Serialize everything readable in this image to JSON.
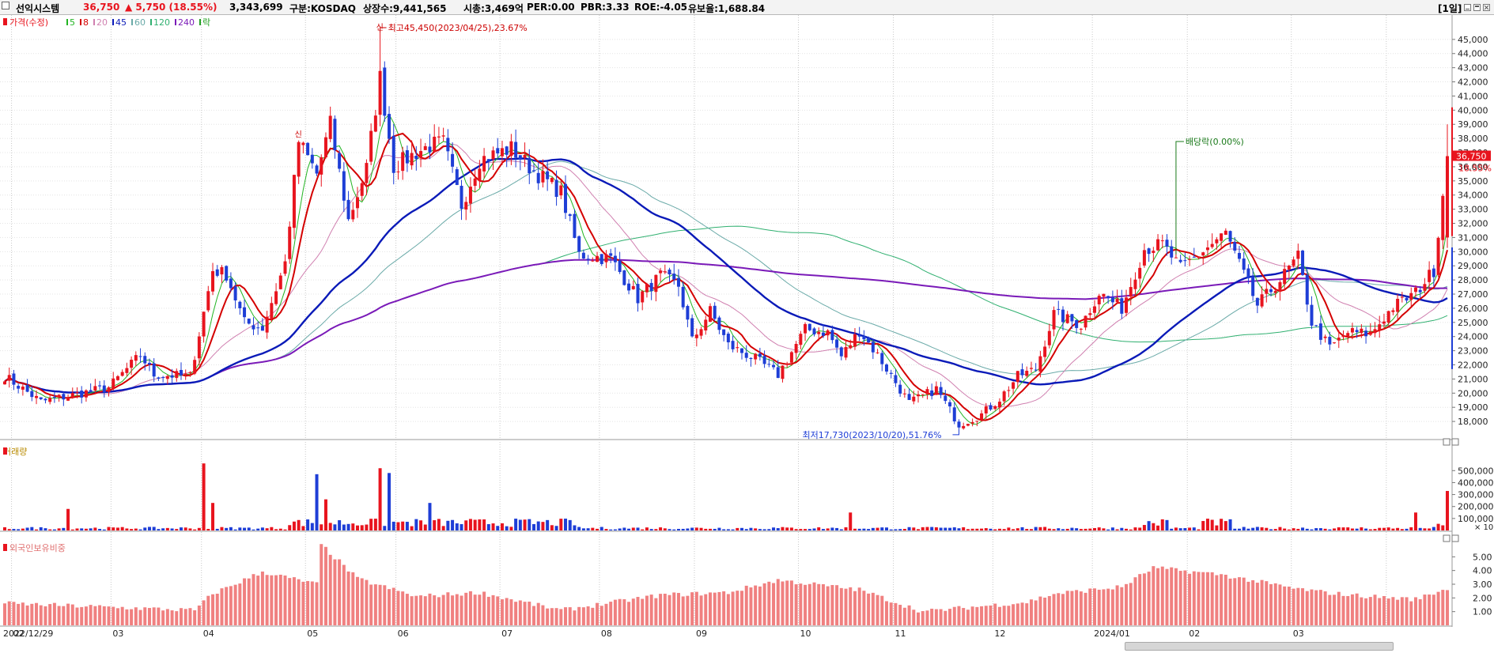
{
  "header": {
    "name": "선익시스템",
    "price": "36,750",
    "change": "▲ 5,750 (18.55%)",
    "volume": "3,343,699",
    "market": "구분:KOSDAQ",
    "shares": "상장수:9,441,565",
    "mcap": "시총:3,469억",
    "per": "PER:0.00",
    "pbr": "PBR:3.33",
    "roe": "ROE:-4.05",
    "retention": "유보율:1,688.84",
    "period": "[1일]"
  },
  "colors": {
    "up": "#e8141e",
    "down": "#1e3ed6",
    "ma5": "#22b422",
    "ma8": "#d40000",
    "ma20": "#d080b0",
    "ma45": "#0a1ab8",
    "ma60": "#6aaaa8",
    "ma120": "#30b070",
    "ma240": "#7a1ab8",
    "foreign": "#f08080"
  },
  "chart_data": [
    {
      "type": "candlestick",
      "legend": [
        {
          "label": "가격(수정)",
          "color": "#e8141e"
        },
        {
          "label": "5",
          "color": "#22b422"
        },
        {
          "label": "8",
          "color": "#d40000"
        },
        {
          "label": "20",
          "color": "#d080b0"
        },
        {
          "label": "45",
          "color": "#0a1ab8"
        },
        {
          "label": "60",
          "color": "#6aaaa8"
        },
        {
          "label": "120",
          "color": "#30b070"
        },
        {
          "label": "240",
          "color": "#7a1ab8"
        },
        {
          "label": "락",
          "color": "#22a022"
        }
      ],
      "ylim": [
        17000,
        46500
      ],
      "y_ticks": [
        18000,
        19000,
        20000,
        21000,
        22000,
        23000,
        24000,
        25000,
        26000,
        27000,
        28000,
        29000,
        30000,
        31000,
        32000,
        33000,
        34000,
        35000,
        36000,
        37000,
        38000,
        39000,
        40000,
        41000,
        42000,
        43000,
        44000,
        45000
      ],
      "y_tick_labels": [
        "18,000",
        "19,000",
        "20,000",
        "21,000",
        "22,000",
        "23,000",
        "24,000",
        "25,000",
        "26,000",
        "27,000",
        "28,000",
        "29,000",
        "30,000",
        "31,000",
        "32,000",
        "33,000",
        "34,000",
        "35,000",
        "36,000",
        "37,000",
        "38,000",
        "39,000",
        "40,000",
        "41,000",
        "42,000",
        "43,000",
        "44,000",
        "45,000"
      ],
      "x_labels": [
        "2022/12/29",
        "02",
        "03",
        "04",
        "05",
        "06",
        "07",
        "08",
        "09",
        "10",
        "11",
        "12",
        "2024/01",
        "02",
        "03"
      ],
      "last_price_label": "36,750",
      "last_change_label": "18.55%",
      "annotations": {
        "high": "최고45,450(2023/04/25),23.67%",
        "low": "최저17,730(2023/10/20),51.76%",
        "dividend": "배당락(0.00%)",
        "new_high_marks": [
          "신",
          "신"
        ]
      },
      "price_path": [
        [
          "2022-12-29",
          21200
        ],
        [
          "2023-01-10",
          19400
        ],
        [
          "2023-01-31",
          20400
        ],
        [
          "2023-02-09",
          22700
        ],
        [
          "2023-02-14",
          21300
        ],
        [
          "2023-02-24",
          21200
        ],
        [
          "2023-03-03",
          28700
        ],
        [
          "2023-03-08",
          28400
        ],
        [
          "2023-03-14",
          25000
        ],
        [
          "2023-03-20",
          24600
        ],
        [
          "2023-03-27",
          29200
        ],
        [
          "2023-03-30",
          37800
        ],
        [
          "2023-04-05",
          35500
        ],
        [
          "2023-04-10",
          39000
        ],
        [
          "2023-04-14",
          32200
        ],
        [
          "2023-04-20",
          35900
        ],
        [
          "2023-04-25",
          42300
        ],
        [
          "2023-04-28",
          36000
        ],
        [
          "2023-05-05",
          37000
        ],
        [
          "2023-05-10",
          37500
        ],
        [
          "2023-05-15",
          37700
        ],
        [
          "2023-05-19",
          33300
        ],
        [
          "2023-05-25",
          36500
        ],
        [
          "2023-06-05",
          37300
        ],
        [
          "2023-06-12",
          35700
        ],
        [
          "2023-06-20",
          34200
        ],
        [
          "2023-06-26",
          29800
        ],
        [
          "2023-07-05",
          29500
        ],
        [
          "2023-07-13",
          26700
        ],
        [
          "2023-07-20",
          28300
        ],
        [
          "2023-07-26",
          27600
        ],
        [
          "2023-07-31",
          23700
        ],
        [
          "2023-08-04",
          25800
        ],
        [
          "2023-08-10",
          23400
        ],
        [
          "2023-08-18",
          22400
        ],
        [
          "2023-08-25",
          21300
        ],
        [
          "2023-09-04",
          24500
        ],
        [
          "2023-09-11",
          24300
        ],
        [
          "2023-09-14",
          22600
        ],
        [
          "2023-09-20",
          24400
        ],
        [
          "2023-09-26",
          22700
        ],
        [
          "2023-10-05",
          19300
        ],
        [
          "2023-10-13",
          20300
        ],
        [
          "2023-10-20",
          17800
        ],
        [
          "2023-10-27",
          18500
        ],
        [
          "2023-11-02",
          19600
        ],
        [
          "2023-11-08",
          21200
        ],
        [
          "2023-11-14",
          21700
        ],
        [
          "2023-11-20",
          25600
        ],
        [
          "2023-11-28",
          24800
        ],
        [
          "2023-12-04",
          27100
        ],
        [
          "2023-12-11",
          26000
        ],
        [
          "2023-12-18",
          30200
        ],
        [
          "2023-12-22",
          30500
        ],
        [
          "2023-12-28",
          28800
        ],
        [
          "2024-01-05",
          30300
        ],
        [
          "2024-01-11",
          31300
        ],
        [
          "2024-01-16",
          29100
        ],
        [
          "2024-01-22",
          26200
        ],
        [
          "2024-01-29",
          28000
        ],
        [
          "2024-02-02",
          29600
        ],
        [
          "2024-02-07",
          25000
        ],
        [
          "2024-02-13",
          23200
        ],
        [
          "2024-02-19",
          24300
        ],
        [
          "2024-02-26",
          24200
        ],
        [
          "2024-03-04",
          26100
        ],
        [
          "2024-03-11",
          27100
        ],
        [
          "2024-03-15",
          28700
        ],
        [
          "2024-03-20",
          36750
        ]
      ]
    },
    {
      "type": "bar",
      "title": "거래량",
      "ylim": [
        0,
        700000
      ],
      "y_ticks": [
        100000,
        200000,
        300000,
        400000,
        500000
      ],
      "y_tick_labels": [
        "100,000",
        "200,000",
        "300,000",
        "400,000",
        "500,000"
      ],
      "unit_label": "× 10",
      "peaks": [
        [
          "2023-01-18",
          180000
        ],
        [
          "2023-03-01",
          560000
        ],
        [
          "2023-03-03",
          230000
        ],
        [
          "2023-04-05",
          470000
        ],
        [
          "2023-04-07",
          260000
        ],
        [
          "2023-04-25",
          520000
        ],
        [
          "2023-04-27",
          480000
        ],
        [
          "2023-05-10",
          230000
        ],
        [
          "2023-09-18",
          150000
        ],
        [
          "2024-03-11",
          150000
        ],
        [
          "2024-03-20",
          330000
        ]
      ]
    },
    {
      "type": "bar",
      "title": "외국인보유비중",
      "ylim": [
        0,
        6
      ],
      "y_ticks": [
        1,
        2,
        3,
        4,
        5
      ],
      "y_tick_labels": [
        "1.00",
        "2.00",
        "3.00",
        "4.00",
        "5.00"
      ],
      "path": [
        [
          "2022-12-29",
          1.6
        ],
        [
          "2023-02-27",
          1.1
        ],
        [
          "2023-03-03",
          2.3
        ],
        [
          "2023-03-20",
          3.9
        ],
        [
          "2023-04-05",
          3.0
        ],
        [
          "2023-04-06",
          5.9
        ],
        [
          "2023-04-18",
          3.4
        ],
        [
          "2023-05-05",
          2.1
        ],
        [
          "2023-05-25",
          2.4
        ],
        [
          "2023-06-20",
          1.1
        ],
        [
          "2023-07-20",
          2.2
        ],
        [
          "2023-08-10",
          2.4
        ],
        [
          "2023-08-25",
          3.3
        ],
        [
          "2023-09-20",
          2.6
        ],
        [
          "2023-10-10",
          1.0
        ],
        [
          "2023-11-10",
          1.7
        ],
        [
          "2023-11-20",
          2.3
        ],
        [
          "2023-12-10",
          2.8
        ],
        [
          "2023-12-20",
          4.2
        ],
        [
          "2024-01-10",
          3.7
        ],
        [
          "2024-02-01",
          2.7
        ],
        [
          "2024-02-10",
          2.4
        ],
        [
          "2024-02-20",
          2.2
        ],
        [
          "2024-03-10",
          1.9
        ],
        [
          "2024-03-20",
          2.7
        ]
      ]
    }
  ]
}
